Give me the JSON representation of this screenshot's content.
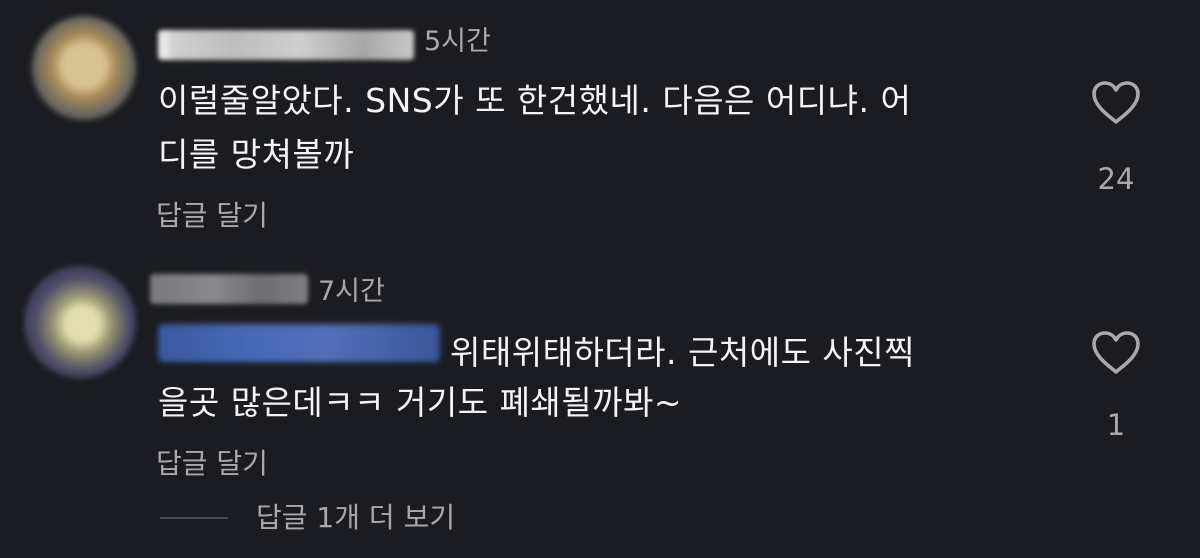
{
  "comments": [
    {
      "time": "5시간",
      "text_line1": "이럴줄알았다. SNS가 또 한건했네. 다음은 어디냐. 어",
      "text_line2": "디를 망쳐볼까",
      "reply_label": "답글 달기",
      "like_count": "24"
    },
    {
      "time": "7시간",
      "text_line1": "위태위태하더라.  근처에도 사진찍",
      "text_line2": "을곳 많은데ㅋㅋ 거기도 폐쇄될까봐~",
      "reply_label": "답글 달기",
      "like_count": "1"
    }
  ],
  "more_replies_label": "답글 1개 더 보기",
  "colors": {
    "background": "#1b1c21",
    "text": "#f4f4f4",
    "muted": "#a8a8ad",
    "mention": "#4b6fbf"
  },
  "icons": {
    "like": "heart-outline-icon"
  }
}
